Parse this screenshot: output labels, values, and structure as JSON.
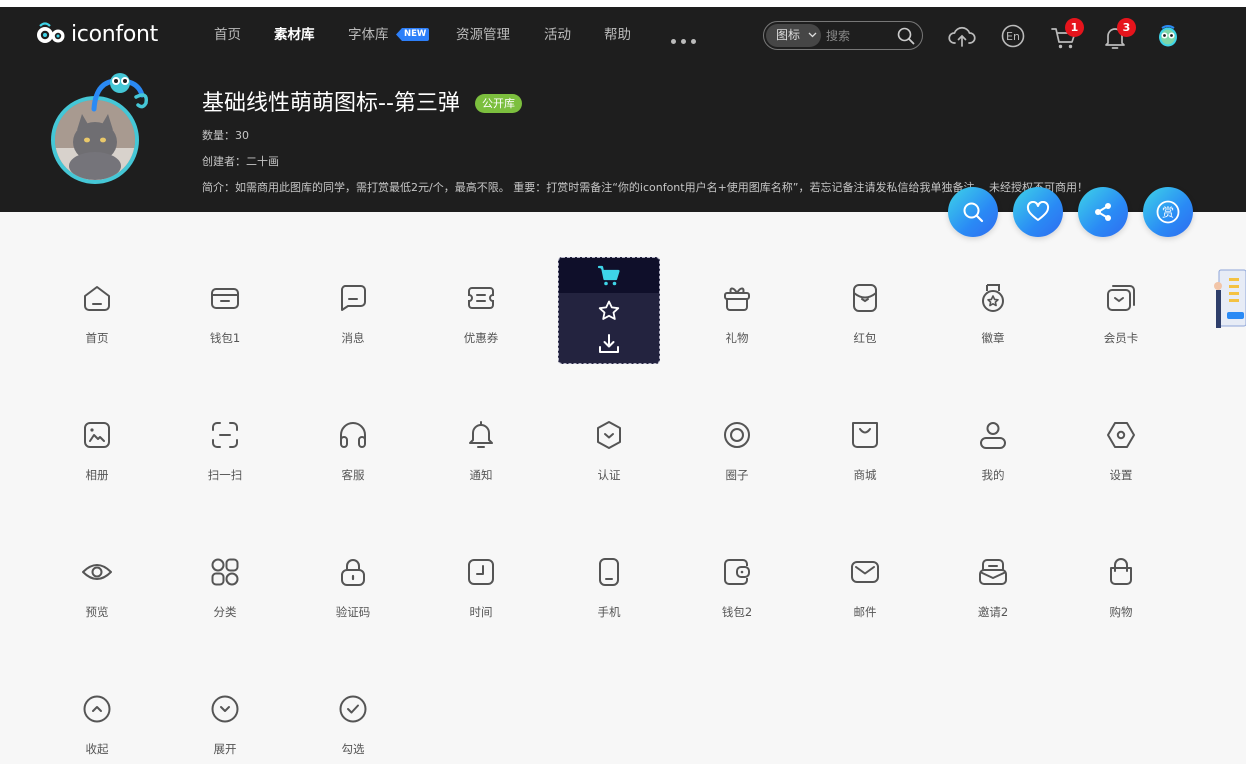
{
  "nav": {
    "logo_text": "iconfont",
    "items": [
      {
        "label": "首页",
        "active": false
      },
      {
        "label": "素材库",
        "active": true
      },
      {
        "label": "字体库",
        "active": false,
        "badge": "NEW"
      },
      {
        "label": "资源管理",
        "active": false
      },
      {
        "label": "活动",
        "active": false
      },
      {
        "label": "帮助",
        "active": false
      }
    ],
    "search": {
      "type_label": "图标",
      "placeholder": "搜索"
    },
    "cart_count": "1",
    "notification_count": "3"
  },
  "library": {
    "title": "基础线性萌萌图标--第三弹",
    "tag": "公开库",
    "count_line": "数量：30",
    "creator_line": "创建者：二十画",
    "intro_line": "简介：如需商用此图库的同学，需打赏最低2元/个，最高不限。 重要：打赏时需备注“你的iconfont用户名+使用图库名称”，若忘记备注请发私信给我单独备注。 未经授权不可商用！"
  },
  "fab": [
    {
      "name": "search"
    },
    {
      "name": "favorite"
    },
    {
      "name": "share"
    },
    {
      "name": "reward",
      "label": "赏"
    }
  ],
  "icons": [
    {
      "label": "首页",
      "icon": "home-icon"
    },
    {
      "label": "钱包1",
      "icon": "wallet-icon"
    },
    {
      "label": "消息",
      "icon": "message-icon"
    },
    {
      "label": "优惠券",
      "icon": "coupon-icon"
    },
    {
      "label": "",
      "icon": "hovered-icon"
    },
    {
      "label": "礼物",
      "icon": "gift-icon"
    },
    {
      "label": "红包",
      "icon": "red-packet-icon"
    },
    {
      "label": "徽章",
      "icon": "badge-icon"
    },
    {
      "label": "会员卡",
      "icon": "member-card-icon"
    },
    {
      "label": "相册",
      "icon": "album-icon"
    },
    {
      "label": "扫一扫",
      "icon": "scan-icon"
    },
    {
      "label": "客服",
      "icon": "headset-icon"
    },
    {
      "label": "通知",
      "icon": "bell-icon"
    },
    {
      "label": "认证",
      "icon": "verify-icon"
    },
    {
      "label": "圈子",
      "icon": "circle-icon"
    },
    {
      "label": "商城",
      "icon": "mall-icon"
    },
    {
      "label": "我的",
      "icon": "user-icon"
    },
    {
      "label": "设置",
      "icon": "settings-icon"
    },
    {
      "label": "预览",
      "icon": "eye-icon"
    },
    {
      "label": "分类",
      "icon": "category-icon"
    },
    {
      "label": "验证码",
      "icon": "lock-icon"
    },
    {
      "label": "时间",
      "icon": "clock-icon"
    },
    {
      "label": "手机",
      "icon": "phone-icon"
    },
    {
      "label": "钱包2",
      "icon": "wallet2-icon"
    },
    {
      "label": "邮件",
      "icon": "mail-icon"
    },
    {
      "label": "邀请2",
      "icon": "invite-icon"
    },
    {
      "label": "购物",
      "icon": "shopping-bag-icon"
    },
    {
      "label": "收起",
      "icon": "chevron-up-circle-icon"
    },
    {
      "label": "展开",
      "icon": "chevron-down-circle-icon"
    },
    {
      "label": "勾选",
      "icon": "check-circle-icon"
    }
  ],
  "colors": {
    "header_bg": "#1e1e1e",
    "accent_cyan": "#3ed4e8",
    "accent_blue": "#2a8af5",
    "tag_green": "#7cbf3e",
    "badge_red": "#e6141c",
    "icon_stroke": "#555555"
  }
}
